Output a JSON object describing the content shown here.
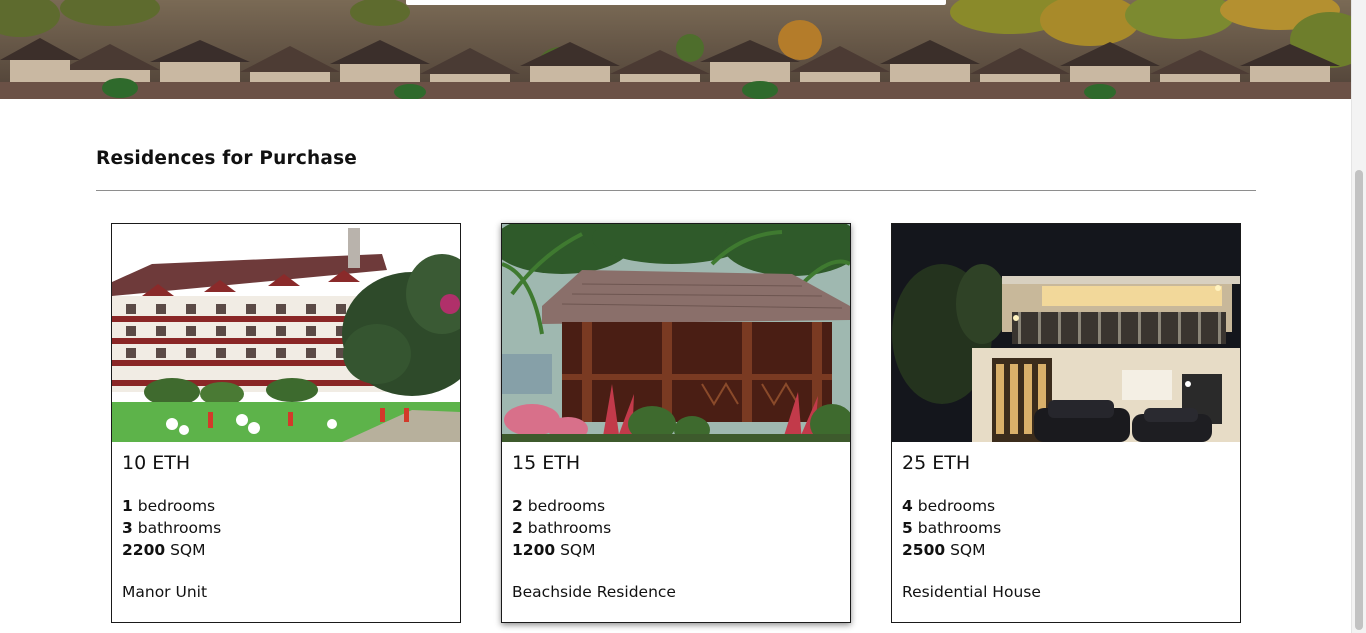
{
  "section": {
    "title": "Residences for Purchase"
  },
  "listings": [
    {
      "price": "10 ETH",
      "bedrooms": "1",
      "bedrooms_label": "bedrooms",
      "bathrooms": "3",
      "bathrooms_label": "bathrooms",
      "area": "2200",
      "area_unit": "SQM",
      "name": "Manor Unit"
    },
    {
      "price": "15 ETH",
      "bedrooms": "2",
      "bedrooms_label": "bedrooms",
      "bathrooms": "2",
      "bathrooms_label": "bathrooms",
      "area": "1200",
      "area_unit": "SQM",
      "name": "Beachside Residence"
    },
    {
      "price": "25 ETH",
      "bedrooms": "4",
      "bedrooms_label": "bedrooms",
      "bathrooms": "5",
      "bathrooms_label": "bathrooms",
      "area": "2500",
      "area_unit": "SQM",
      "name": "Residential House"
    }
  ],
  "colors": {
    "card_border": "#1a1a1a",
    "divider": "#8e8e8e",
    "text": "#111111"
  }
}
